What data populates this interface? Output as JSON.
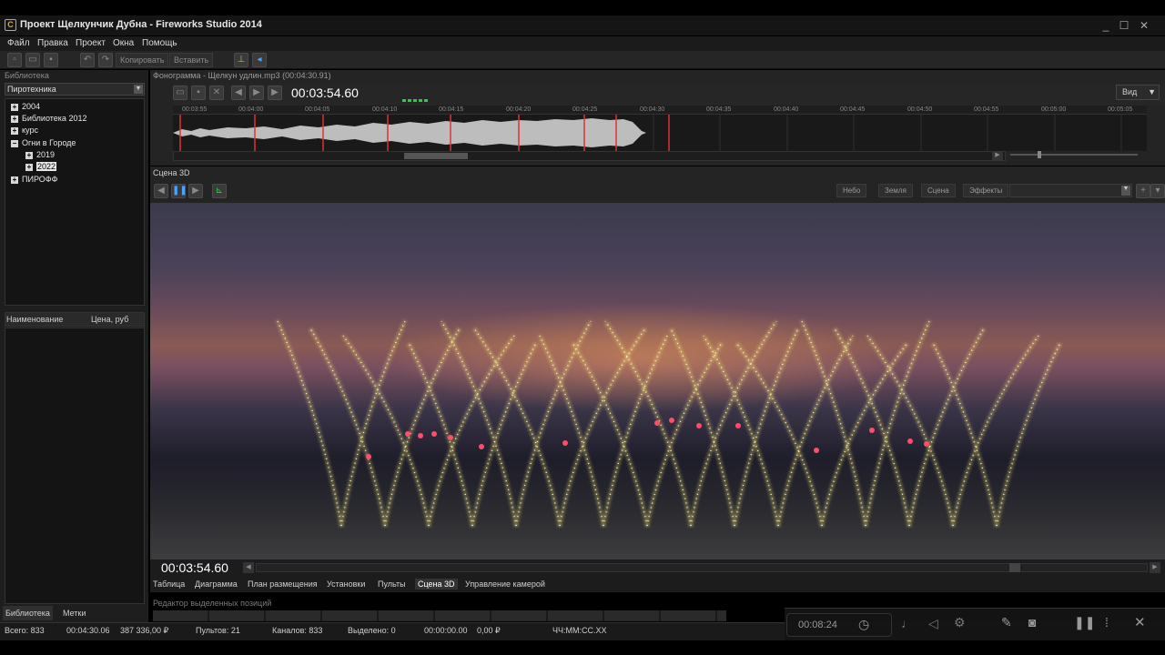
{
  "window": {
    "title": "Проект Щелкунчик Дубна - Fireworks Studio 2014",
    "controls": [
      "_",
      "☐",
      "✕"
    ]
  },
  "menu": [
    "Файл",
    "Правка",
    "Проект",
    "Окна",
    "Помощь"
  ],
  "toolbar": {
    "copy_label": "Копировать",
    "paste_label": "Вставить"
  },
  "library": {
    "header": "Библиотека",
    "combo_value": "Пиротехника",
    "tree": [
      {
        "label": "2004",
        "expander": "+",
        "level": 0
      },
      {
        "label": "Библиотека 2012",
        "expander": "+",
        "level": 0
      },
      {
        "label": "курс",
        "expander": "+",
        "level": 0
      },
      {
        "label": "Огни в Городе",
        "expander": "−",
        "level": 0
      },
      {
        "label": "2019",
        "expander": "+",
        "level": 1
      },
      {
        "label": "2022",
        "expander": "+",
        "level": 1,
        "selected": true
      },
      {
        "label": "ПИРОФФ",
        "expander": "+",
        "level": 0
      }
    ],
    "list_columns": [
      "Наименование",
      "Цена, руб"
    ],
    "tabs": [
      "Библиотека",
      "Метки"
    ]
  },
  "track": {
    "title": "Фонограмма - Щелкун удлин.mp3 (00:04:30.91)",
    "current_time": "00:03:54.60",
    "view_label": "Вид",
    "ruler": [
      "00:03:55",
      "00:04:00",
      "00:04:05",
      "00:04:10",
      "00:04:15",
      "00:04:20",
      "00:04:25",
      "00:04:30",
      "00:04:35",
      "00:04:40",
      "00:04:45",
      "00:04:50",
      "00:04:55",
      "00:05:00",
      "00:05:05"
    ]
  },
  "scene": {
    "title": "Сцена 3D",
    "view_buttons": [
      "Небо",
      "Земля",
      "Сцена",
      "Эффекты"
    ],
    "time": "00:03:54.60"
  },
  "bottom_tabs": [
    "Таблица",
    "Диаграмма",
    "План размещения",
    "Установки",
    "Пульты",
    "Сцена 3D",
    "Управление камерой"
  ],
  "active_tab": "Сцена 3D",
  "editor_title": "Редактор выделенных позиций",
  "status": {
    "total": "Всего: 833",
    "duration": "00:04:30.06",
    "cost": "387 336,00 ₽",
    "consoles": "Пультов: 21",
    "channels": "Каналов: 833",
    "selected": "Выделено: 0",
    "sel_time": "00:00:00.00",
    "sel_cost": "0,00 ₽",
    "format": "ЧЧ:ММ:СС.ХХ"
  },
  "overlay": {
    "timer": "00:08:24"
  },
  "colors": {
    "accent": "#d9a441",
    "waveform": "#bdbdbd",
    "marker": "#d33",
    "spark": "#f2e27a"
  }
}
